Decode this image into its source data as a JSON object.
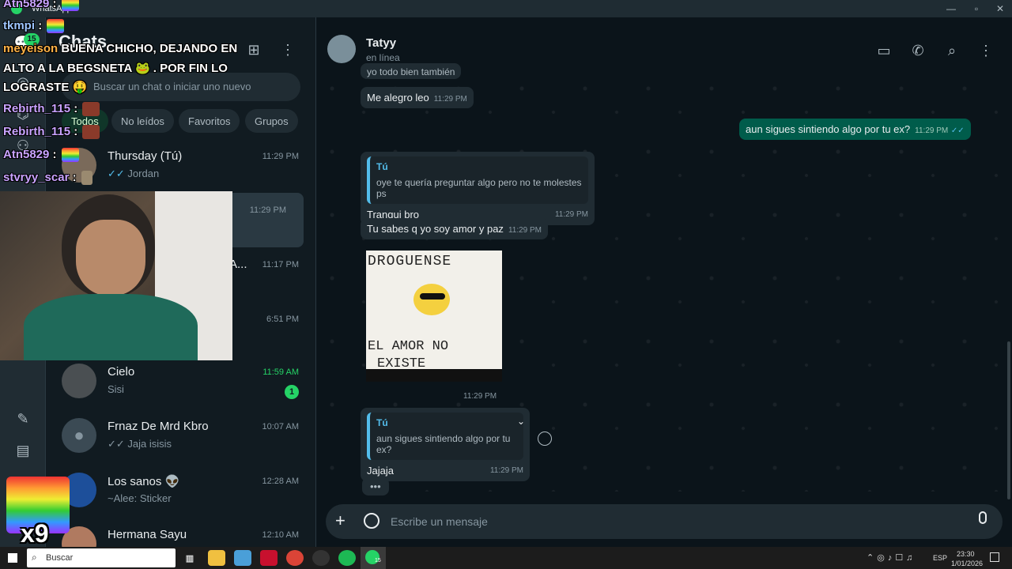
{
  "window": {
    "title": "WhatsApp"
  },
  "sidebar": {
    "title": "Chats",
    "search_placeholder": "Buscar un chat o iniciar uno nuevo",
    "filters": [
      "Todos",
      "No leídos",
      "Favoritos",
      "Grupos"
    ],
    "rail_badge": "15",
    "chats": [
      {
        "name": "Thursday (Tú)",
        "message": "Jordan",
        "time": "11:29 PM",
        "ticks": "✓✓"
      },
      {
        "name": "",
        "message": "",
        "time": "11:29 PM"
      },
      {
        "name": "A...",
        "message": "",
        "time": "11:17 PM"
      },
      {
        "name": "",
        "message": "",
        "time": "6:51 PM"
      },
      {
        "name": "Cielo",
        "message": "Sisi",
        "time": "11:59 AM",
        "unread": "1"
      },
      {
        "name": "Frnaz De Mrd Kbro",
        "message": "Jaja isisis",
        "time": "10:07 AM",
        "ticks": "✓✓"
      },
      {
        "name": "Los sanos 👽",
        "message": "~Alee: Sticker",
        "time": "12:28 AM"
      },
      {
        "name": "Hermana Sayu",
        "message": "",
        "time": "12:10 AM"
      }
    ]
  },
  "conversation": {
    "contact_name": "Tatyy",
    "contact_status": "en línea",
    "messages": {
      "m0_partial": "yo todo bien también",
      "m1": {
        "text": "Me alegro leo",
        "time": "11:29 PM"
      },
      "m2": {
        "text": "aun sigues sintiendo algo por tu ex?",
        "time": "11:29 PM",
        "ticks": "✓✓"
      },
      "m3": {
        "quote_author": "Tú",
        "quote_text": "oye te quería preguntar algo pero no te molestes ps",
        "text": "Tranqui bro",
        "time": "11:29 PM"
      },
      "m4": {
        "text": "Tu sabes q yo soy amor y paz",
        "time": "11:29 PM"
      },
      "m5": {
        "image_top": "DROGUENSE",
        "image_bottom_1": "EL AMOR NO",
        "image_bottom_2": "EXISTE",
        "time": "11:29 PM"
      },
      "m6": {
        "quote_author": "Tú",
        "quote_text": "aun sigues sintiendo algo por tu ex?",
        "text": "Jajaja",
        "time": "11:29 PM"
      }
    },
    "typing": "•••",
    "composer_placeholder": "Escribe un mensaje"
  },
  "stream_chat": [
    {
      "user": "Atn5829",
      "msg": ":"
    },
    {
      "user": "tkmpi",
      "msg": ":"
    },
    {
      "user": "meyeison",
      "msg": "BUENA CHICHO, DEJANDO EN"
    },
    {
      "user": "",
      "msg": "ALTO A LA BEGSNETA 🐸 . POR FIN LO"
    },
    {
      "user": "",
      "msg": "LOGRASTE 🤑"
    },
    {
      "user": "Rebirth_115",
      "msg": ":"
    },
    {
      "user": "Rebirth_115",
      "msg": ":"
    },
    {
      "user": "Atn5829",
      "msg": ":"
    },
    {
      "user": "stvryy_scar",
      "msg": ":"
    }
  ],
  "overlay": {
    "multiplier": "x9"
  },
  "taskbar": {
    "search": "Buscar",
    "lang": "ESP",
    "time": "23:30",
    "date": "1/01/2026",
    "whatsapp_badge": "15"
  }
}
